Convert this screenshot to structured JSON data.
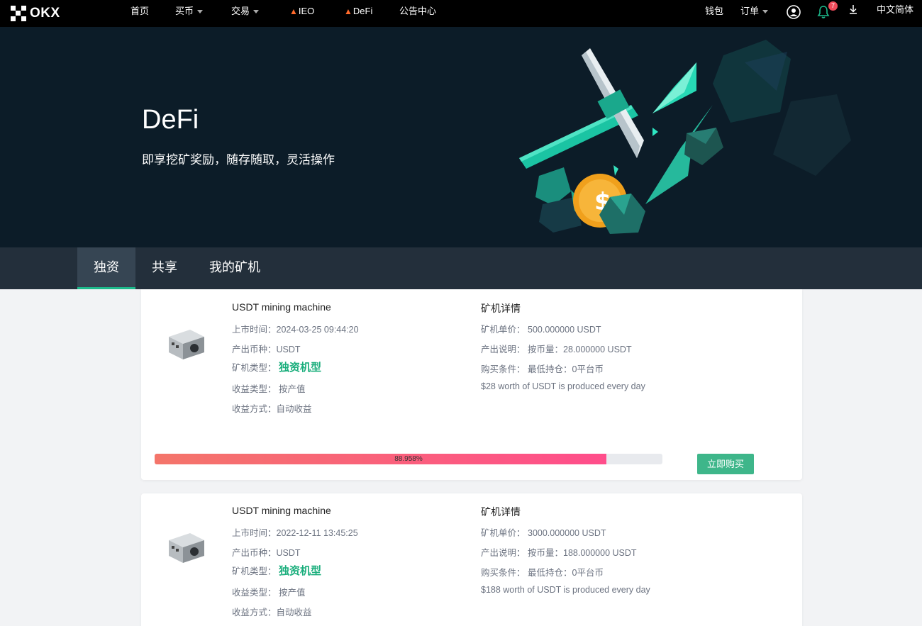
{
  "nav": {
    "logo": "OKX",
    "items": [
      "首页",
      "买币",
      "交易",
      "IEO",
      "DeFi",
      "公告中心"
    ],
    "right": {
      "wallet": "钱包",
      "orders": "订单",
      "notifications": "7",
      "language": "中文简体"
    }
  },
  "hero": {
    "title": "DeFi",
    "subtitle": "即享挖矿奖励，随存随取，灵活操作"
  },
  "tabs": [
    "独资",
    "共享",
    "我的矿机"
  ],
  "cards": [
    {
      "title": "USDT mining machine",
      "listed_label": "上市时间：",
      "listed": "2024-03-25 09:44:20",
      "coin_label": "产出币种：",
      "coin": "USDT",
      "type_label": "矿机类型：",
      "type": "独资机型",
      "income_type_label": "收益类型：",
      "income_type": "按产值",
      "income_method_label": "收益方式：",
      "income_method": "自动收益",
      "detail_title": "矿机详情",
      "price_label": "矿机单价：",
      "price": "500.000000 USDT",
      "output_label": "产出说明：",
      "output": "按币量：28.000000 USDT",
      "condition_label": "购买条件：",
      "condition": "最低持仓：0平台币",
      "daily": "$28 worth of USDT is produced every day",
      "progress": 88.958,
      "progress_text": "88.958%",
      "buy": "立即购买"
    },
    {
      "title": "USDT mining machine",
      "listed_label": "上市时间：",
      "listed": "2022-12-11 13:45:25",
      "coin_label": "产出币种：",
      "coin": "USDT",
      "type_label": "矿机类型：",
      "type": "独资机型",
      "income_type_label": "收益类型：",
      "income_type": "按产值",
      "income_method_label": "收益方式：",
      "income_method": "自动收益",
      "detail_title": "矿机详情",
      "price_label": "矿机单价：",
      "price": "3000.000000 USDT",
      "output_label": "产出说明：",
      "output": "按币量：188.000000 USDT",
      "condition_label": "购买条件：",
      "condition": "最低持仓：0平台币",
      "daily": "$188 worth of USDT is produced every day"
    }
  ],
  "colors": {
    "accent": "#1cb98b",
    "hero_bg": "#0c1c28",
    "tab_bg": "#232f3b",
    "buy": "#3eb68a"
  }
}
